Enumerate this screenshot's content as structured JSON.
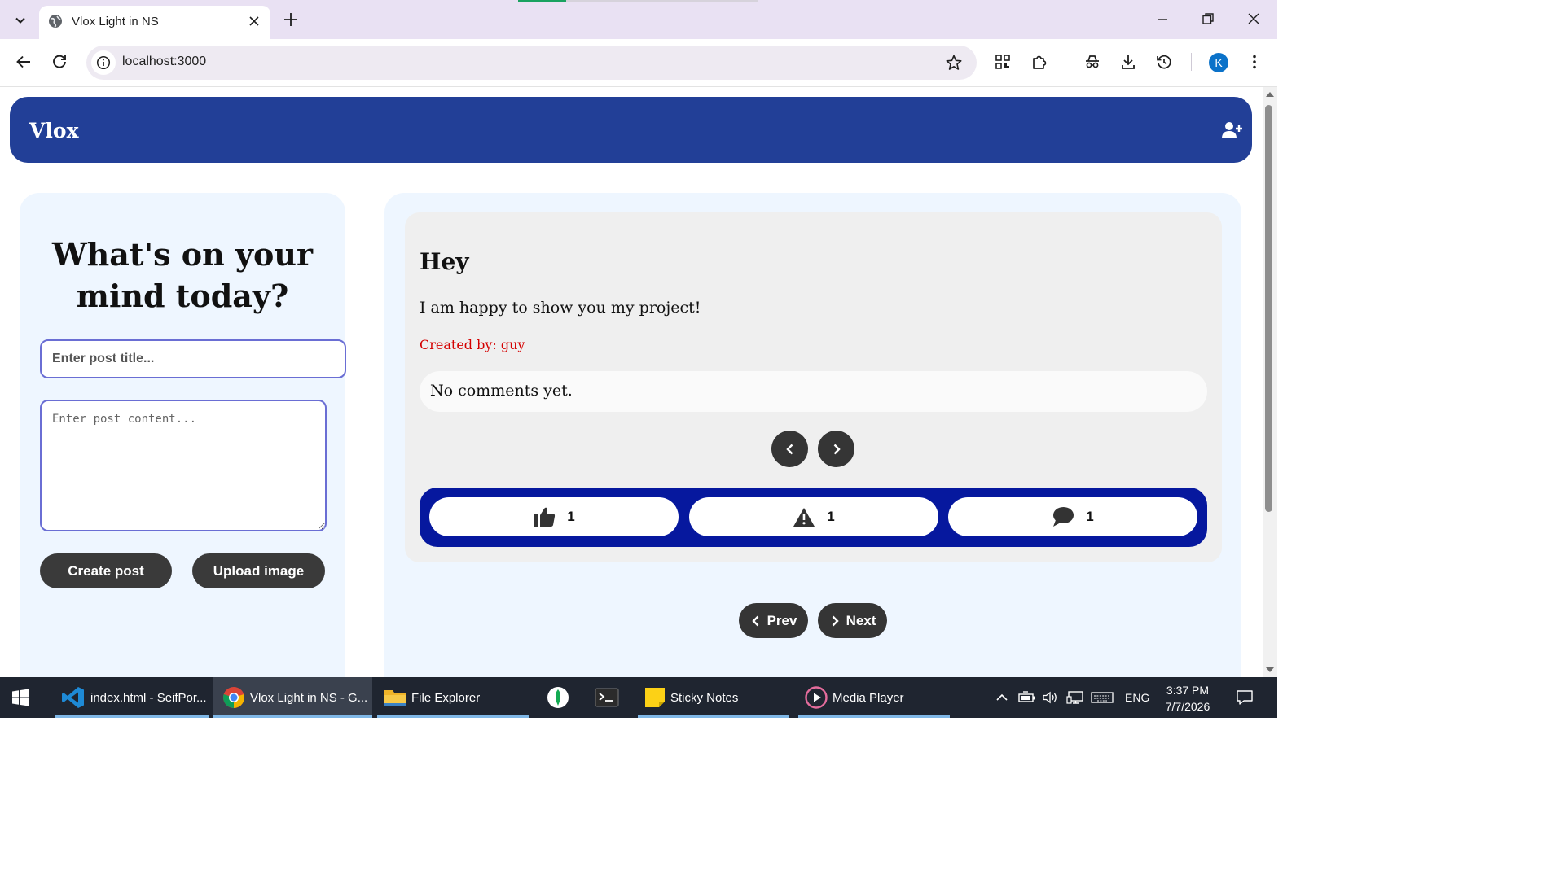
{
  "browser": {
    "tab_title": "Vlox Light in NS",
    "url": "localhost:3000",
    "profile_initial": "K"
  },
  "app": {
    "brand": "Vlox",
    "composer": {
      "heading": "What's on your mind today?",
      "title_placeholder": "Enter post title...",
      "content_placeholder": "Enter post content...",
      "create_label": "Create post",
      "upload_label": "Upload image"
    },
    "post": {
      "title": "Hey",
      "content": "I am happy to show you my project!",
      "author": "Created by: guy",
      "comments_text": "No comments yet.",
      "likes": "1",
      "reports": "1",
      "comment_count": "1"
    },
    "pager": {
      "prev_label": "Prev",
      "next_label": "Next"
    }
  },
  "taskbar": {
    "items": [
      {
        "label": "index.html - SeifPor..."
      },
      {
        "label": "Vlox Light in NS - G..."
      },
      {
        "label": "File Explorer"
      },
      {
        "label": "Sticky Notes"
      },
      {
        "label": "Media Player"
      }
    ],
    "language": "ENG",
    "time": "3:37 PM",
    "date": "7/7/2026"
  },
  "colors": {
    "navbar": "#223f97",
    "action_bar": "#06189e",
    "author": "#d40000",
    "panel": "#eef6ff"
  }
}
